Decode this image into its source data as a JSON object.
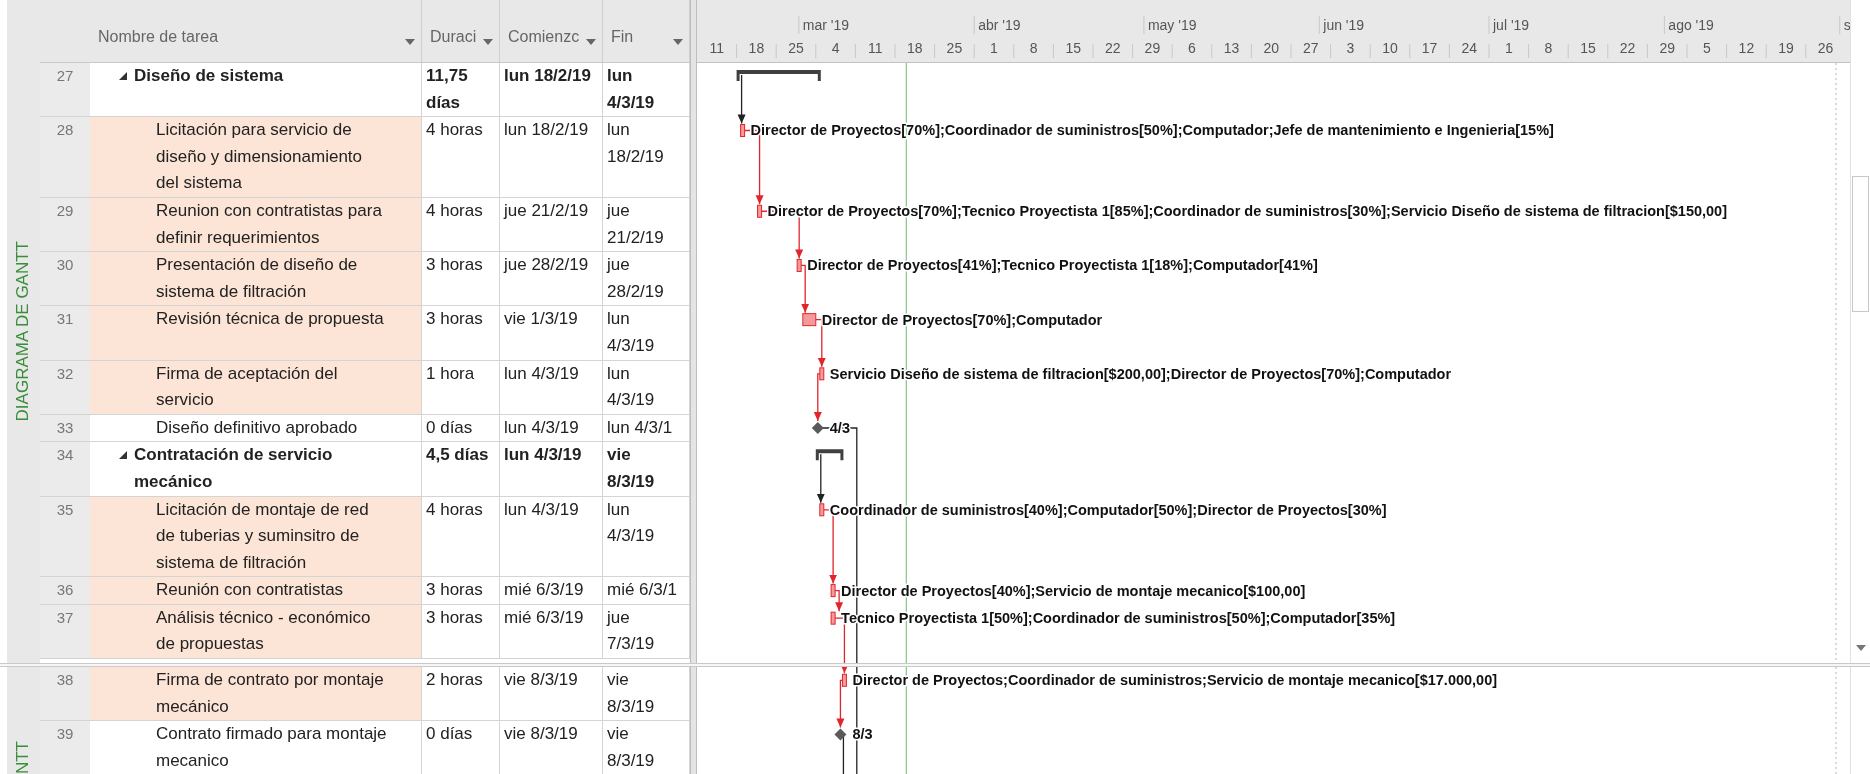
{
  "views": [
    {
      "label": "DIAGRAMA DE GANTT"
    },
    {
      "label": "NTT"
    }
  ],
  "columns": [
    {
      "label": "Nombre de tarea"
    },
    {
      "label": "Duraci"
    },
    {
      "label": "Comienzc"
    },
    {
      "label": "Fin"
    }
  ],
  "timescale": {
    "months": [
      {
        "label": "mar '19"
      },
      {
        "label": "abr '19"
      },
      {
        "label": "may '19"
      },
      {
        "label": "jun '19"
      },
      {
        "label": "jul '19"
      },
      {
        "label": "ago '19"
      },
      {
        "label": "s"
      }
    ],
    "weeks": [
      {
        "label": "11"
      },
      {
        "label": "18"
      },
      {
        "label": "25"
      },
      {
        "label": "4"
      },
      {
        "label": "11"
      },
      {
        "label": "18"
      },
      {
        "label": "25"
      },
      {
        "label": "1"
      },
      {
        "label": "8"
      },
      {
        "label": "15"
      },
      {
        "label": "22"
      },
      {
        "label": "29"
      },
      {
        "label": "6"
      },
      {
        "label": "13"
      },
      {
        "label": "20"
      },
      {
        "label": "27"
      },
      {
        "label": "3"
      },
      {
        "label": "10"
      },
      {
        "label": "17"
      },
      {
        "label": "24"
      },
      {
        "label": "1"
      },
      {
        "label": "8"
      },
      {
        "label": "15"
      },
      {
        "label": "22"
      },
      {
        "label": "29"
      },
      {
        "label": "5"
      },
      {
        "label": "12"
      },
      {
        "label": "19"
      },
      {
        "label": "26"
      }
    ]
  },
  "panes": [
    {
      "rows": [
        {
          "id": "27",
          "kind": "summary",
          "expanded": true,
          "highlighted": false,
          "name": "Diseño de sistema",
          "duration": "11,75 días",
          "start": "lun 18/2/19",
          "finish": "lun 4/3/19"
        },
        {
          "id": "28",
          "kind": "task",
          "highlighted": true,
          "name": "Licitación para servicio de diseño y dimensionamiento del sistema",
          "duration": "4 horas",
          "start": "lun 18/2/19",
          "finish": "lun 18/2/19",
          "resources": "Director de Proyectos[70%];Coordinador de suministros[50%];Computador;Jefe de mantenimiento e Ingenieria[15%]"
        },
        {
          "id": "29",
          "kind": "task",
          "highlighted": true,
          "name": "Reunion con contratistas para definir requerimientos",
          "duration": "4 horas",
          "start": "jue 21/2/19",
          "finish": "jue 21/2/19",
          "resources": "Director de Proyectos[70%];Tecnico Proyectista 1[85%];Coordinador de suministros[30%];Servicio Diseño de sistema de filtracion[$150,00]"
        },
        {
          "id": "30",
          "kind": "task",
          "highlighted": true,
          "name": "Presentación de diseño de sistema de filtración",
          "duration": "3 horas",
          "start": "jue 28/2/19",
          "finish": "jue 28/2/19",
          "resources": "Director de Proyectos[41%];Tecnico Proyectista 1[18%];Computador[41%]"
        },
        {
          "id": "31",
          "kind": "task",
          "highlighted": true,
          "name": "Revisión técnica de propuesta",
          "duration": "3 horas",
          "start": "vie 1/3/19",
          "finish": "lun 4/3/19",
          "resources": "Director de Proyectos[70%];Computador"
        },
        {
          "id": "32",
          "kind": "task",
          "highlighted": true,
          "name": "Firma de aceptación del servicio",
          "duration": "1 hora",
          "start": "lun 4/3/19",
          "finish": "lun 4/3/19",
          "resources": "Servicio Diseño de sistema de filtracion[$200,00];Director de Proyectos[70%];Computador"
        },
        {
          "id": "33",
          "kind": "milestone",
          "highlighted": false,
          "name": "Diseño definitivo aprobado",
          "duration": "0 días",
          "start": "lun 4/3/19",
          "finish": "lun 4/3/1",
          "date_label": "4/3"
        },
        {
          "id": "34",
          "kind": "summary",
          "expanded": true,
          "highlighted": false,
          "name": "Contratación de servicio mecánico",
          "duration": "4,5 días",
          "start": "lun 4/3/19",
          "finish": "vie 8/3/19"
        },
        {
          "id": "35",
          "kind": "task",
          "highlighted": true,
          "name": "Licitación de montaje de red de tuberias y suminsitro de sistema de filtración",
          "duration": "4 horas",
          "start": "lun 4/3/19",
          "finish": "lun 4/3/19",
          "resources": "Coordinador de suministros[40%];Computador[50%];Director de Proyectos[30%]"
        },
        {
          "id": "36",
          "kind": "task",
          "highlighted": true,
          "name": "Reunión con contratistas",
          "duration": "3 horas",
          "start": "mié 6/3/19",
          "finish": "mié 6/3/1",
          "resources": "Director de Proyectos[40%];Servicio de montaje mecanico[$100,00]"
        },
        {
          "id": "37",
          "kind": "task",
          "highlighted": true,
          "name": "Análisis técnico - económico de propuestas",
          "duration": "3 horas",
          "start": "mié 6/3/19",
          "finish": "jue 7/3/19",
          "resources": "Tecnico Proyectista 1[50%];Coordinador de suministros[50%];Computador[35%]"
        }
      ]
    },
    {
      "rows": [
        {
          "id": "38",
          "kind": "task",
          "highlighted": true,
          "name": "Firma de contrato por montaje mecánico",
          "duration": "2 horas",
          "start": "vie 8/3/19",
          "finish": "vie 8/3/19",
          "resources": "Director de Proyectos;Coordinador de suministros;Servicio de montaje mecanico[$17.000,00]"
        },
        {
          "id": "39",
          "kind": "milestone",
          "highlighted": false,
          "name": "Contrato firmado para montaje mecanico",
          "duration": "0 días",
          "start": "vie 8/3/19",
          "finish": "vie 8/3/19",
          "date_label": "8/3"
        }
      ]
    }
  ]
}
